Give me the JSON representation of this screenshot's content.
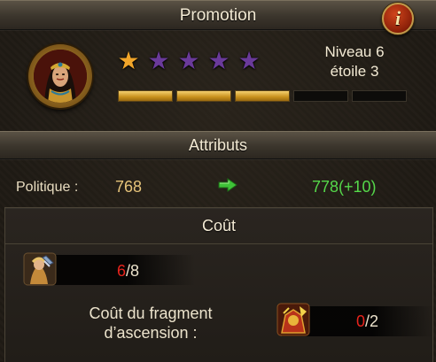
{
  "header": {
    "title": "Promotion",
    "info_icon": "info-icon",
    "info_glyph": "i"
  },
  "hero": {
    "portrait_icon": "hero-portrait-icon",
    "stars_total": 5,
    "stars_filled": 1,
    "level_line1": "Niveau 6",
    "level_line2": "étoile 3",
    "progress_segments_total": 5,
    "progress_segments_filled": 3
  },
  "attributes": {
    "title": "Attributs",
    "label": "Politique :",
    "current": "768",
    "new": "778(+10)",
    "arrow_icon": "green-arrow-icon"
  },
  "cost": {
    "title": "Coût",
    "item1": {
      "icon": "hero-token-icon",
      "have": "6",
      "need": "/8"
    },
    "item2": {
      "label_line1": "Coût du fragment",
      "label_line2": "d’ascension :",
      "icon": "ascension-fragment-icon",
      "have": "0",
      "need": "/2"
    }
  },
  "colors": {
    "star_filled": "#f0a52a",
    "star_empty": "#6a3a9a",
    "progress_fill": "#e2b03a",
    "value_old": "#e6c47a",
    "value_new": "#55d84a",
    "count_short": "#e8231c"
  }
}
